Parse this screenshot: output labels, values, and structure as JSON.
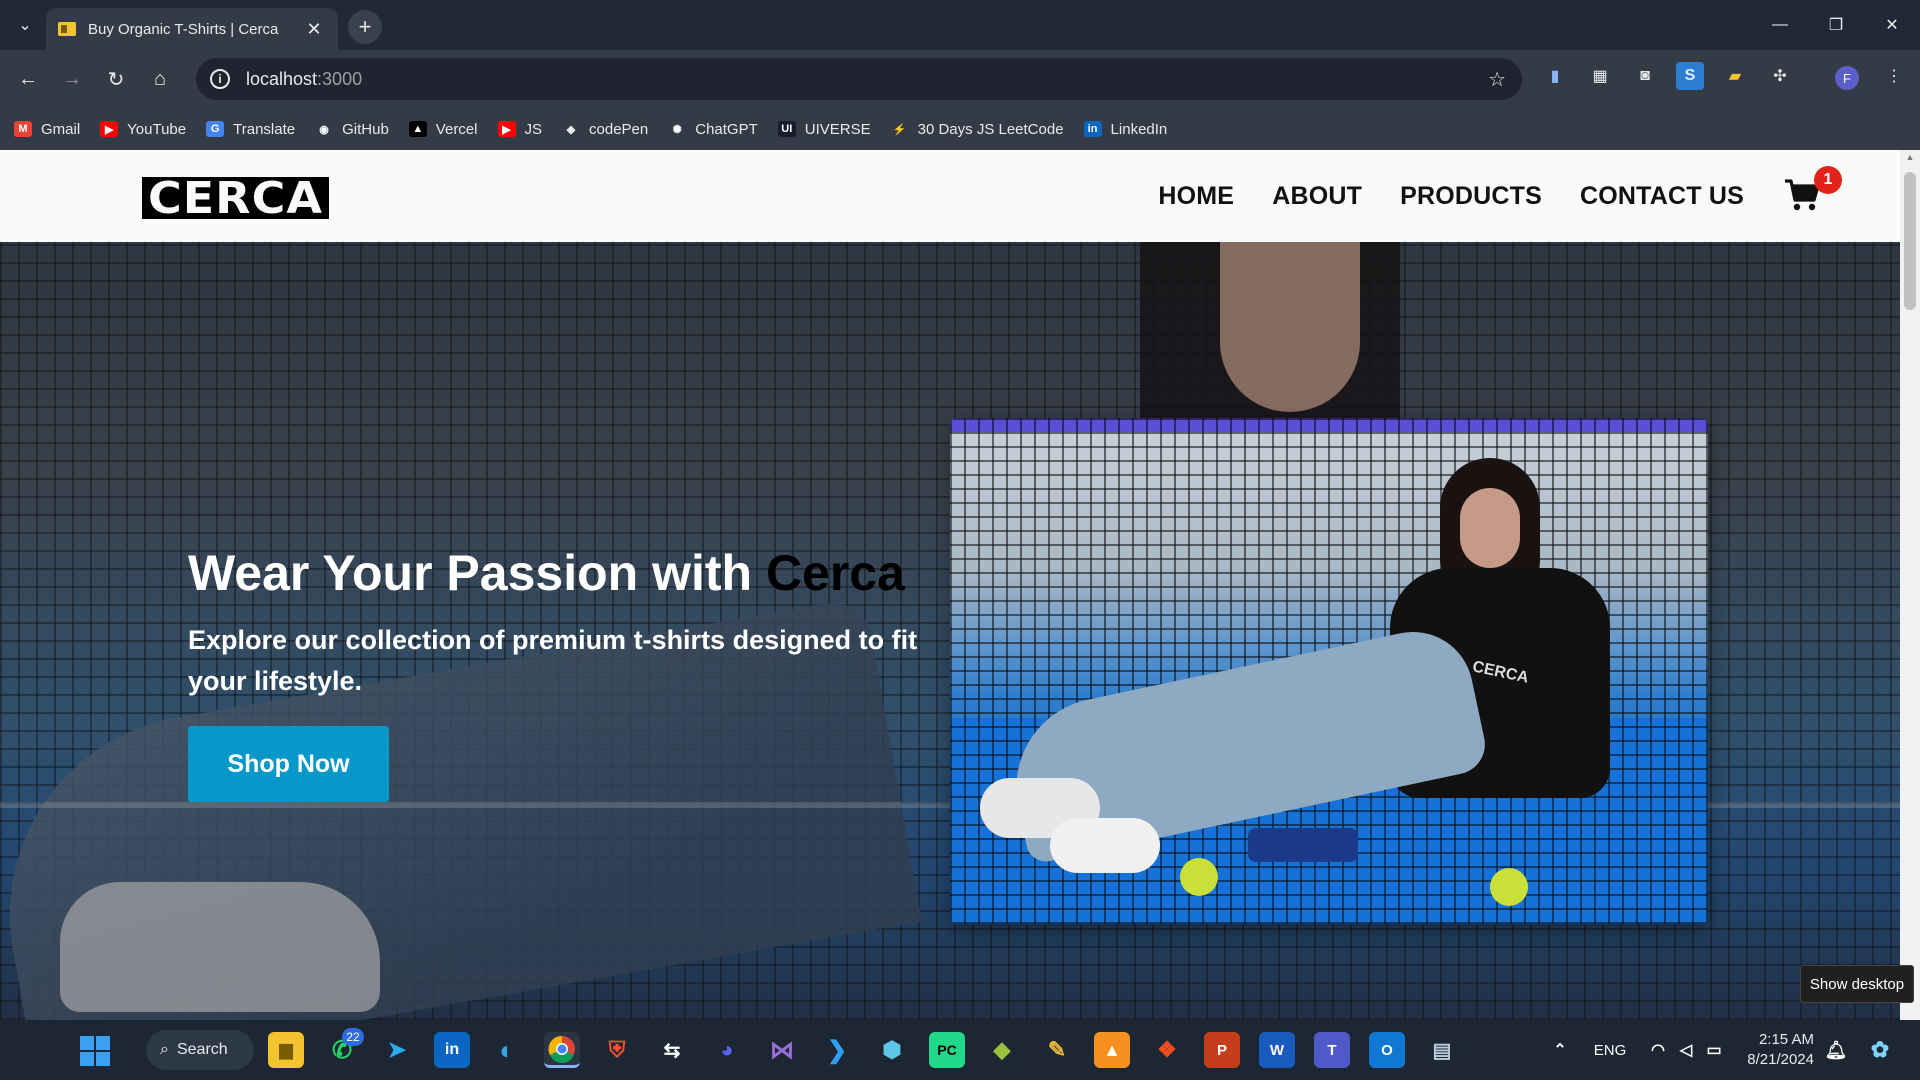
{
  "browser": {
    "tab_title": "Buy Organic T-Shirts | Cerca",
    "tab_close": "✕",
    "new_tab": "+",
    "url_host": "localhost",
    "url_port": ":3000",
    "window_controls": {
      "minimize": "—",
      "restore": "❐",
      "close": "✕"
    },
    "bookmarks": [
      {
        "label": "Gmail",
        "icon": "gmail-icon",
        "color": "#ea4335",
        "glyph": "M"
      },
      {
        "label": "YouTube",
        "icon": "youtube-icon",
        "color": "#ff0000",
        "glyph": "▶"
      },
      {
        "label": "Translate",
        "icon": "translate-icon",
        "color": "#4285f4",
        "glyph": "G"
      },
      {
        "label": "GitHub",
        "icon": "github-icon",
        "color": "#343a46",
        "glyph": "◉"
      },
      {
        "label": "Vercel",
        "icon": "vercel-icon",
        "color": "#000000",
        "glyph": "▲"
      },
      {
        "label": "JS",
        "icon": "youtube-icon",
        "color": "#ff0000",
        "glyph": "▶"
      },
      {
        "label": "codePen",
        "icon": "codepen-icon",
        "color": "#343a46",
        "glyph": "◈"
      },
      {
        "label": "ChatGPT",
        "icon": "chatgpt-icon",
        "color": "#343a46",
        "glyph": "✺"
      },
      {
        "label": "UIVERSE",
        "icon": "uiverse-icon",
        "color": "#1a1a2e",
        "glyph": "UI"
      },
      {
        "label": "30 Days JS LeetCode",
        "icon": "leetcode-icon",
        "color": "#343a46",
        "glyph": "⚡"
      },
      {
        "label": "LinkedIn",
        "icon": "linkedin-icon",
        "color": "#0a66c2",
        "glyph": "in"
      }
    ],
    "profile_initial": "F"
  },
  "site": {
    "logo": "CERCA",
    "nav": [
      "HOME",
      "ABOUT",
      "PRODUCTS",
      "CONTACT US"
    ],
    "cart_count": "1",
    "hero": {
      "title_prefix": "Wear Your Passion with ",
      "title_brand": "Cerca",
      "subtitle": "Explore our collection of premium t-shirts designed to fit your lifestyle.",
      "cta": "Shop Now",
      "shirt_logo": "CERCA"
    }
  },
  "taskbar": {
    "search_label": "Search",
    "whatsapp_badge": "22",
    "language": "ENG",
    "time": "2:15 AM",
    "date": "8/21/2024",
    "show_desktop_tooltip": "Show desktop"
  },
  "colors": {
    "accent": "#0797c9",
    "badge": "#e0241b",
    "chrome_dark": "#1f2937",
    "chrome_mid": "#343a46"
  }
}
